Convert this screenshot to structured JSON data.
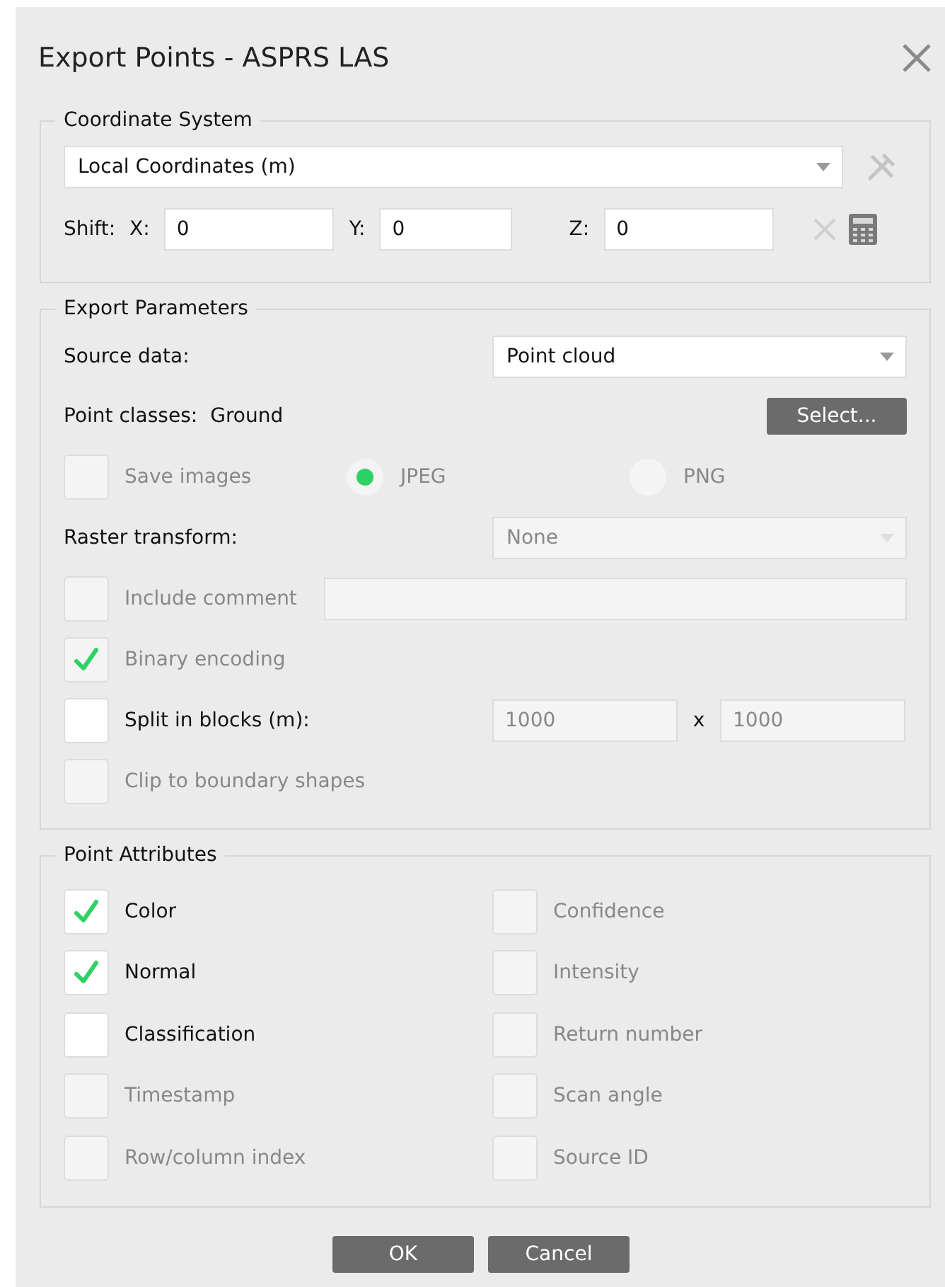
{
  "window": {
    "title": "Export Points - ASPRS LAS"
  },
  "coordinate_system": {
    "legend": "Coordinate System",
    "dropdown": {
      "value": "Local Coordinates (m)"
    },
    "shift_label": "Shift:",
    "shift_fields": [
      {
        "label": "X:",
        "value": "0"
      },
      {
        "label": "Y:",
        "value": "0"
      },
      {
        "label": "Z:",
        "value": "0"
      }
    ]
  },
  "export_parameters": {
    "legend": "Export Parameters",
    "rows": [
      {
        "kind": "dropdown",
        "label": "Source data:",
        "value": "Point cloud",
        "disabled": false
      },
      {
        "kind": "value",
        "label": "Point classes:",
        "value": "Ground",
        "button": "Select..."
      },
      {
        "kind": "checkbox_radio",
        "label": "Save images",
        "checked": false,
        "disabled": true,
        "radios": [
          {
            "label": "JPEG",
            "selected": true
          },
          {
            "label": "PNG",
            "selected": false
          }
        ]
      },
      {
        "kind": "dropdown",
        "label": "Raster transform:",
        "value": "None",
        "disabled": true
      },
      {
        "kind": "checkbox_text",
        "label": "Include comment",
        "checked": false,
        "disabled": true
      },
      {
        "kind": "checkbox",
        "label": "Binary encoding",
        "checked": true,
        "disabled": true
      },
      {
        "kind": "checkbox_size",
        "label": "Split in blocks (m):",
        "checked": false,
        "disabled": false,
        "values": [
          "1000",
          "1000"
        ],
        "separator": "x"
      },
      {
        "kind": "checkbox",
        "label": "Clip to boundary shapes",
        "checked": false,
        "disabled": true
      }
    ]
  },
  "point_attributes": {
    "legend": "Point Attributes",
    "items": [
      {
        "label": "Color",
        "checked": true,
        "disabled": false
      },
      {
        "label": "Confidence",
        "checked": false,
        "disabled": true
      },
      {
        "label": "Normal",
        "checked": true,
        "disabled": false
      },
      {
        "label": "Intensity",
        "checked": false,
        "disabled": true
      },
      {
        "label": "Classification",
        "checked": false,
        "disabled": false
      },
      {
        "label": "Return number",
        "checked": false,
        "disabled": true
      },
      {
        "label": "Timestamp",
        "checked": false,
        "disabled": true
      },
      {
        "label": "Scan angle",
        "checked": false,
        "disabled": true
      },
      {
        "label": "Row/column index",
        "checked": false,
        "disabled": true
      },
      {
        "label": "Source ID",
        "checked": false,
        "disabled": true
      }
    ]
  },
  "buttons": [
    "OK",
    "Cancel"
  ]
}
